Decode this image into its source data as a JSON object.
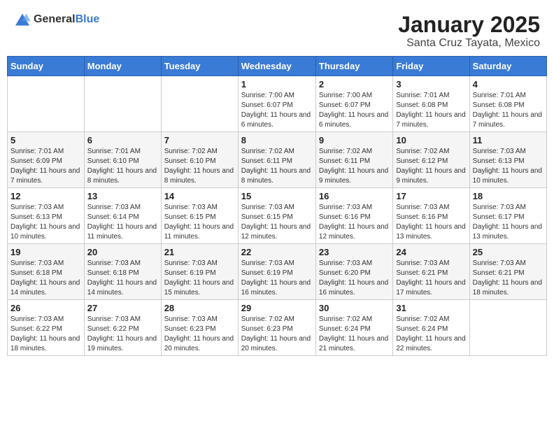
{
  "logo": {
    "general": "General",
    "blue": "Blue"
  },
  "header": {
    "month": "January 2025",
    "location": "Santa Cruz Tayata, Mexico"
  },
  "weekdays": [
    "Sunday",
    "Monday",
    "Tuesday",
    "Wednesday",
    "Thursday",
    "Friday",
    "Saturday"
  ],
  "weeks": [
    [
      {
        "day": "",
        "info": ""
      },
      {
        "day": "",
        "info": ""
      },
      {
        "day": "",
        "info": ""
      },
      {
        "day": "1",
        "info": "Sunrise: 7:00 AM\nSunset: 6:07 PM\nDaylight: 11 hours and 6 minutes."
      },
      {
        "day": "2",
        "info": "Sunrise: 7:00 AM\nSunset: 6:07 PM\nDaylight: 11 hours and 6 minutes."
      },
      {
        "day": "3",
        "info": "Sunrise: 7:01 AM\nSunset: 6:08 PM\nDaylight: 11 hours and 7 minutes."
      },
      {
        "day": "4",
        "info": "Sunrise: 7:01 AM\nSunset: 6:08 PM\nDaylight: 11 hours and 7 minutes."
      }
    ],
    [
      {
        "day": "5",
        "info": "Sunrise: 7:01 AM\nSunset: 6:09 PM\nDaylight: 11 hours and 7 minutes."
      },
      {
        "day": "6",
        "info": "Sunrise: 7:01 AM\nSunset: 6:10 PM\nDaylight: 11 hours and 8 minutes."
      },
      {
        "day": "7",
        "info": "Sunrise: 7:02 AM\nSunset: 6:10 PM\nDaylight: 11 hours and 8 minutes."
      },
      {
        "day": "8",
        "info": "Sunrise: 7:02 AM\nSunset: 6:11 PM\nDaylight: 11 hours and 8 minutes."
      },
      {
        "day": "9",
        "info": "Sunrise: 7:02 AM\nSunset: 6:11 PM\nDaylight: 11 hours and 9 minutes."
      },
      {
        "day": "10",
        "info": "Sunrise: 7:02 AM\nSunset: 6:12 PM\nDaylight: 11 hours and 9 minutes."
      },
      {
        "day": "11",
        "info": "Sunrise: 7:03 AM\nSunset: 6:13 PM\nDaylight: 11 hours and 10 minutes."
      }
    ],
    [
      {
        "day": "12",
        "info": "Sunrise: 7:03 AM\nSunset: 6:13 PM\nDaylight: 11 hours and 10 minutes."
      },
      {
        "day": "13",
        "info": "Sunrise: 7:03 AM\nSunset: 6:14 PM\nDaylight: 11 hours and 11 minutes."
      },
      {
        "day": "14",
        "info": "Sunrise: 7:03 AM\nSunset: 6:15 PM\nDaylight: 11 hours and 11 minutes."
      },
      {
        "day": "15",
        "info": "Sunrise: 7:03 AM\nSunset: 6:15 PM\nDaylight: 11 hours and 12 minutes."
      },
      {
        "day": "16",
        "info": "Sunrise: 7:03 AM\nSunset: 6:16 PM\nDaylight: 11 hours and 12 minutes."
      },
      {
        "day": "17",
        "info": "Sunrise: 7:03 AM\nSunset: 6:16 PM\nDaylight: 11 hours and 13 minutes."
      },
      {
        "day": "18",
        "info": "Sunrise: 7:03 AM\nSunset: 6:17 PM\nDaylight: 11 hours and 13 minutes."
      }
    ],
    [
      {
        "day": "19",
        "info": "Sunrise: 7:03 AM\nSunset: 6:18 PM\nDaylight: 11 hours and 14 minutes."
      },
      {
        "day": "20",
        "info": "Sunrise: 7:03 AM\nSunset: 6:18 PM\nDaylight: 11 hours and 14 minutes."
      },
      {
        "day": "21",
        "info": "Sunrise: 7:03 AM\nSunset: 6:19 PM\nDaylight: 11 hours and 15 minutes."
      },
      {
        "day": "22",
        "info": "Sunrise: 7:03 AM\nSunset: 6:19 PM\nDaylight: 11 hours and 16 minutes."
      },
      {
        "day": "23",
        "info": "Sunrise: 7:03 AM\nSunset: 6:20 PM\nDaylight: 11 hours and 16 minutes."
      },
      {
        "day": "24",
        "info": "Sunrise: 7:03 AM\nSunset: 6:21 PM\nDaylight: 11 hours and 17 minutes."
      },
      {
        "day": "25",
        "info": "Sunrise: 7:03 AM\nSunset: 6:21 PM\nDaylight: 11 hours and 18 minutes."
      }
    ],
    [
      {
        "day": "26",
        "info": "Sunrise: 7:03 AM\nSunset: 6:22 PM\nDaylight: 11 hours and 18 minutes."
      },
      {
        "day": "27",
        "info": "Sunrise: 7:03 AM\nSunset: 6:22 PM\nDaylight: 11 hours and 19 minutes."
      },
      {
        "day": "28",
        "info": "Sunrise: 7:03 AM\nSunset: 6:23 PM\nDaylight: 11 hours and 20 minutes."
      },
      {
        "day": "29",
        "info": "Sunrise: 7:02 AM\nSunset: 6:23 PM\nDaylight: 11 hours and 20 minutes."
      },
      {
        "day": "30",
        "info": "Sunrise: 7:02 AM\nSunset: 6:24 PM\nDaylight: 11 hours and 21 minutes."
      },
      {
        "day": "31",
        "info": "Sunrise: 7:02 AM\nSunset: 6:24 PM\nDaylight: 11 hours and 22 minutes."
      },
      {
        "day": "",
        "info": ""
      }
    ]
  ]
}
